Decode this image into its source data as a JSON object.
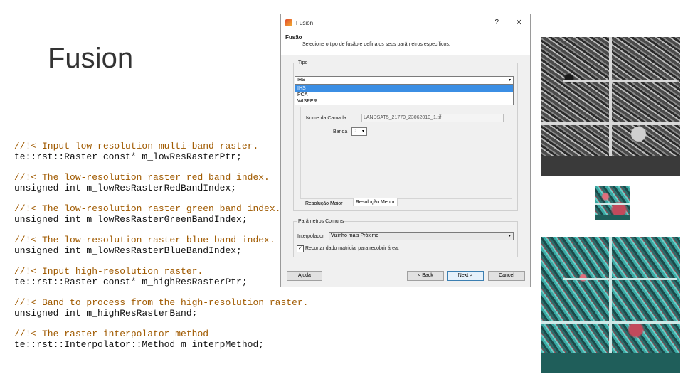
{
  "slide": {
    "title": "Fusion",
    "code": [
      {
        "comment": "//!< Input low-resolution multi-band raster.",
        "decl": "te::rst::Raster const* m_lowResRasterPtr;"
      },
      {
        "comment": "//!< The low-resolution raster red band index.",
        "decl": "unsigned int m_lowResRasterRedBandIndex;"
      },
      {
        "comment": "//!< The low-resolution raster green band index.",
        "decl": "unsigned int m_lowResRasterGreenBandIndex;"
      },
      {
        "comment": "//!< The low-resolution raster blue band index.",
        "decl": "unsigned int m_lowResRasterBlueBandIndex;"
      },
      {
        "comment": "//!< Input high-resolution raster.",
        "decl": "te::rst::Raster const* m_highResRasterPtr;"
      },
      {
        "comment": "//!< Band to process from the high-resolution raster.",
        "decl": "unsigned int m_highResRasterBand;"
      },
      {
        "comment": "//!< The raster interpolator method",
        "decl": "te::rst::Interpolator::Method m_interpMethod;"
      }
    ]
  },
  "dialog": {
    "window_title": "Fusion",
    "help_glyph": "?",
    "close_glyph": "✕",
    "header_title": "Fusão",
    "header_subtitle": "Selecione o tipo de fusão e defina os seus parâmetros específicos.",
    "tipo_group": "Tipo",
    "tipo_selected": "IHS",
    "tipo_options": [
      "IHS",
      "PCA",
      "WISPER"
    ],
    "nome_camada_label": "Nome da Camada",
    "nome_camada_value": "LANDSAT5_21770_23062010_1.tif",
    "banda_label": "Banda",
    "banda_value": "0",
    "tab_maior": "Resolução Maior",
    "tab_menor": "Resolução Menor",
    "params_group": "Parâmetros Comuns",
    "interpolador_label": "Interpolador",
    "interpolador_value": "Vizinho mais Próximo",
    "recortar_label": "Recortar dado matricial para recobrir área.",
    "recortar_checked": "✓",
    "btn_ajuda": "Ajuda",
    "btn_voltar": "< Back",
    "btn_proximo": "Next >",
    "btn_cancelar": "Cancel",
    "arrow_glyph": "▾"
  }
}
